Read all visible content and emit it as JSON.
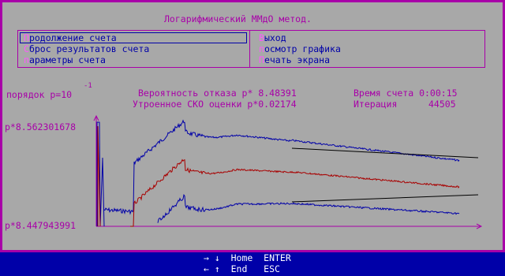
{
  "title": "Логарифмический ММдО метод.",
  "menu": {
    "left": [
      {
        "hotkey": "П",
        "rest": "родолжение счета"
      },
      {
        "hotkey": "С",
        "rest": "брос результатов счета"
      },
      {
        "hotkey": "п",
        "rest": "араметры счета"
      }
    ],
    "right": [
      {
        "hotkey": "В",
        "rest": "ыход"
      },
      {
        "hotkey": "п",
        "rest": "осмотр графика"
      },
      {
        "hotkey": "П",
        "rest": "ечать экрана"
      }
    ]
  },
  "status": {
    "order_label": "порядок p=10",
    "order_exponent": "-1",
    "probability_label": "Вероятность отказа p* 8.48391",
    "time_label": "Время счета 0:00:15",
    "rmse_label": "Утроенное СКО оценки p*0.02174",
    "iteration_label": "Итерация",
    "iteration_value": "44505"
  },
  "chart_data": {
    "type": "line",
    "y_top_label": "p*8.562301678",
    "y_bottom_label": "p*8.447943991",
    "ylim": [
      8.447943991,
      8.562301678
    ],
    "x_range": [
      0,
      44505
    ],
    "grid": false,
    "series": [
      {
        "color": "#0000a8"
      },
      {
        "color": "#a80000"
      },
      {
        "color": "#0000a8"
      },
      {
        "color": "#000000"
      },
      {
        "color": "#000000"
      }
    ]
  },
  "footer": {
    "row1": "→ ↓  Home  ENTER",
    "row2": "← ↑  End   ESC"
  }
}
